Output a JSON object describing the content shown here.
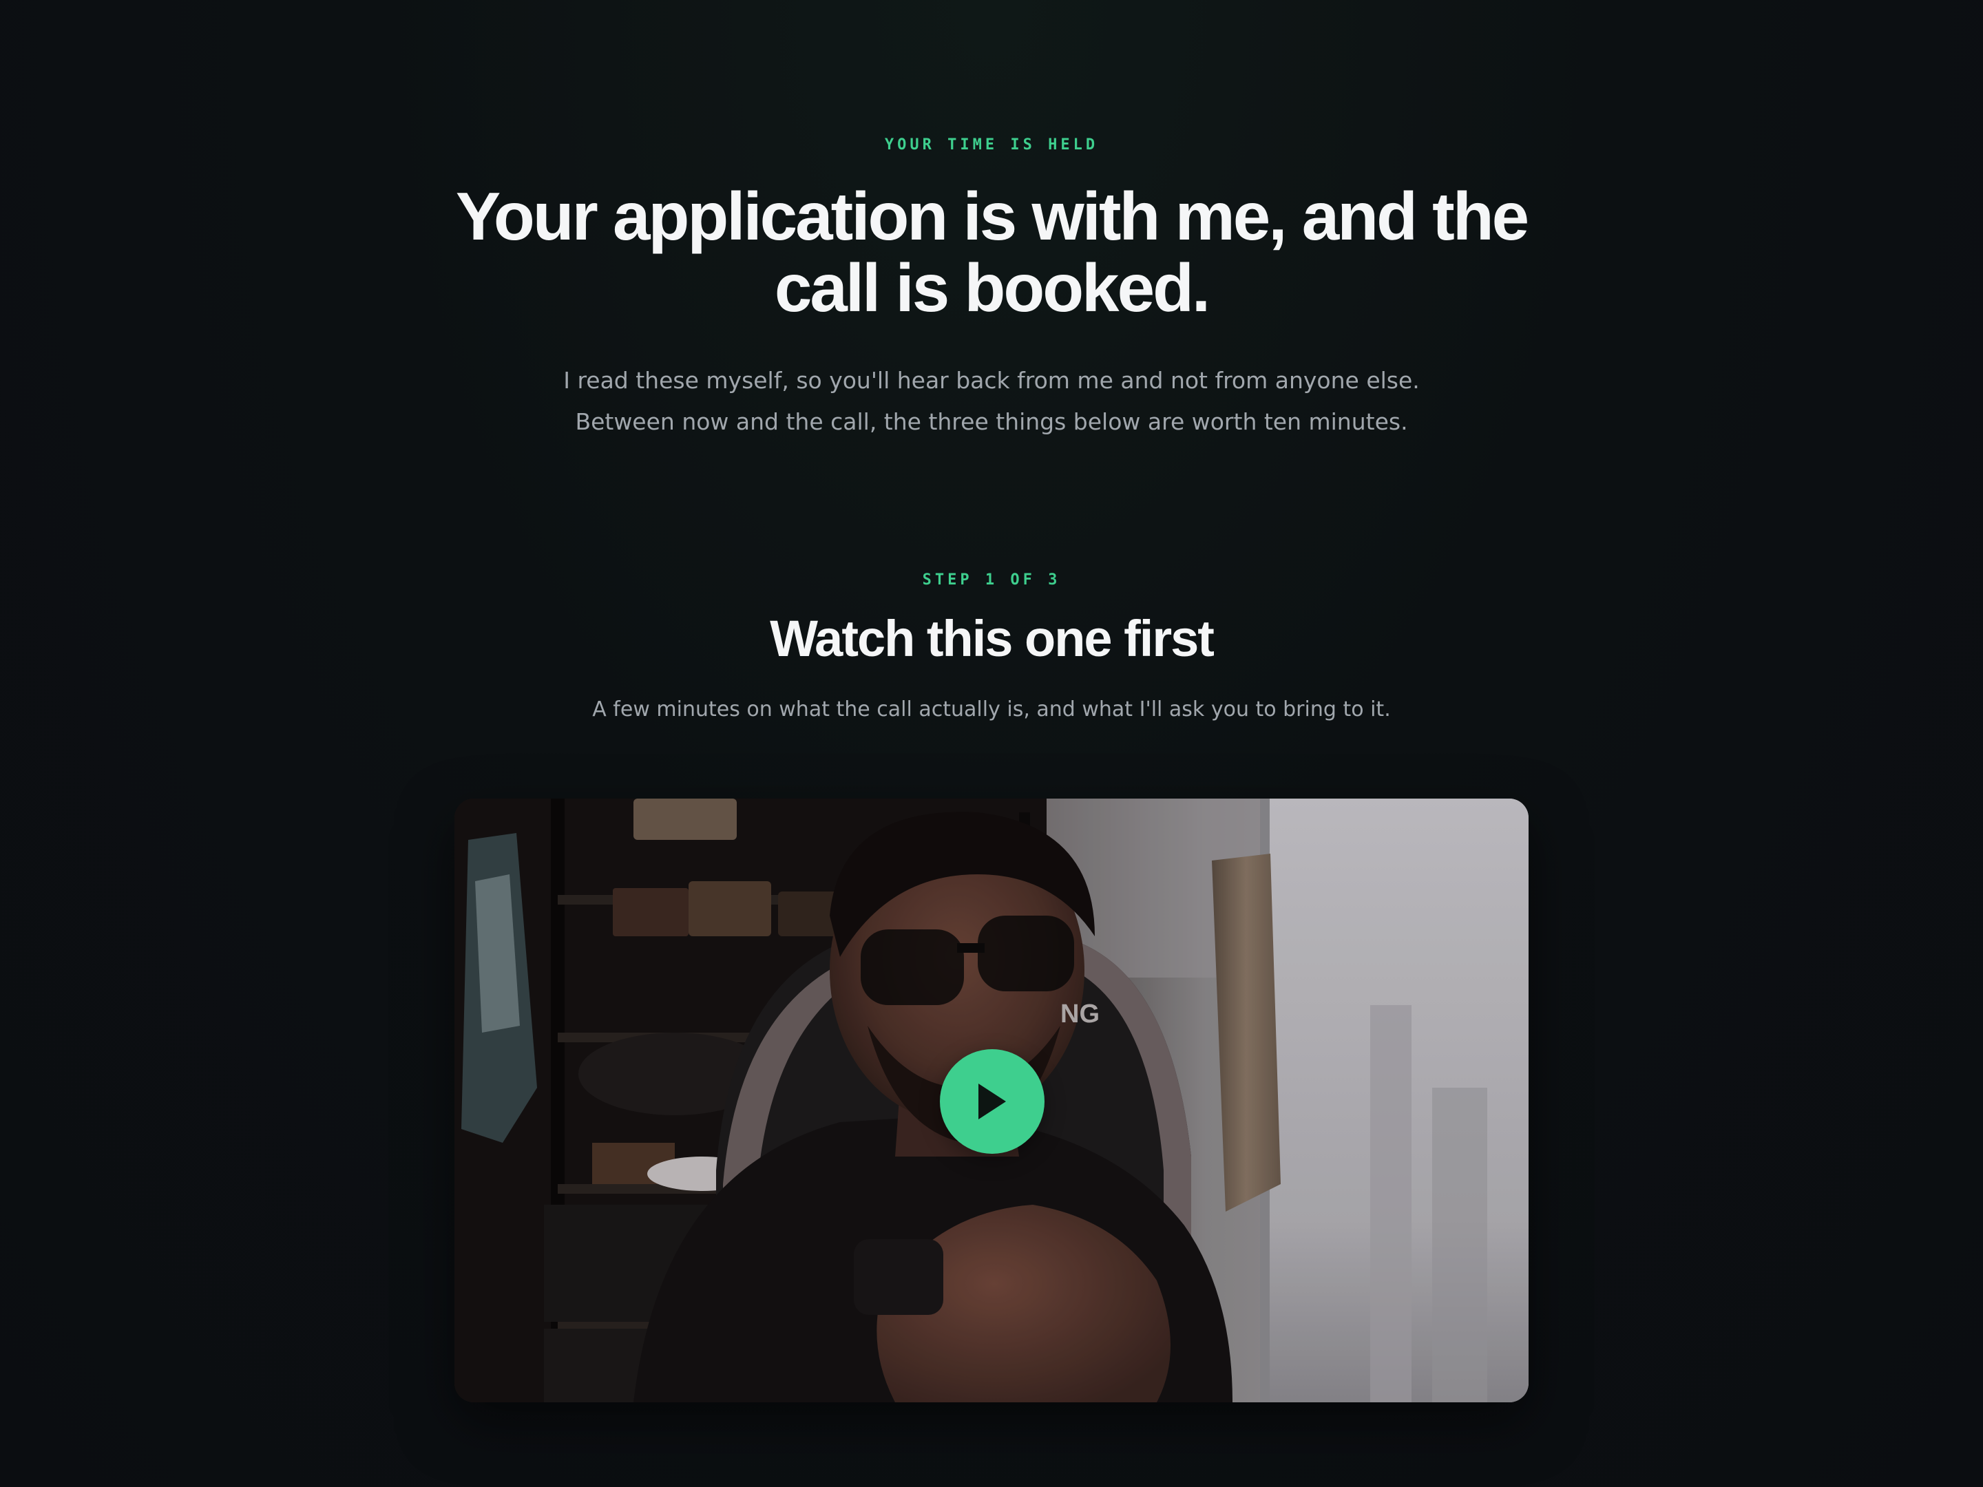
{
  "colors": {
    "accent": "#3ecf8e",
    "heading": "#f5f6f7",
    "muted_text": "#a1a7ad",
    "background": "#0b0d11"
  },
  "hero": {
    "eyebrow": "YOUR TIME IS HELD",
    "headline": "Your application is with me, and the call is booked.",
    "subtext_line1": "I read these myself, so you'll hear back from me and not from anyone else.",
    "subtext_line2": "Between now and the call, the three things below are worth ten minutes."
  },
  "step": {
    "eyebrow": "STEP 1 OF 3",
    "title": "Watch this one first",
    "description": "A few minutes on what the call actually is, and what I'll ask you to bring to it."
  },
  "video": {
    "play_icon": "play-icon",
    "chair_logo_text": "NG"
  }
}
